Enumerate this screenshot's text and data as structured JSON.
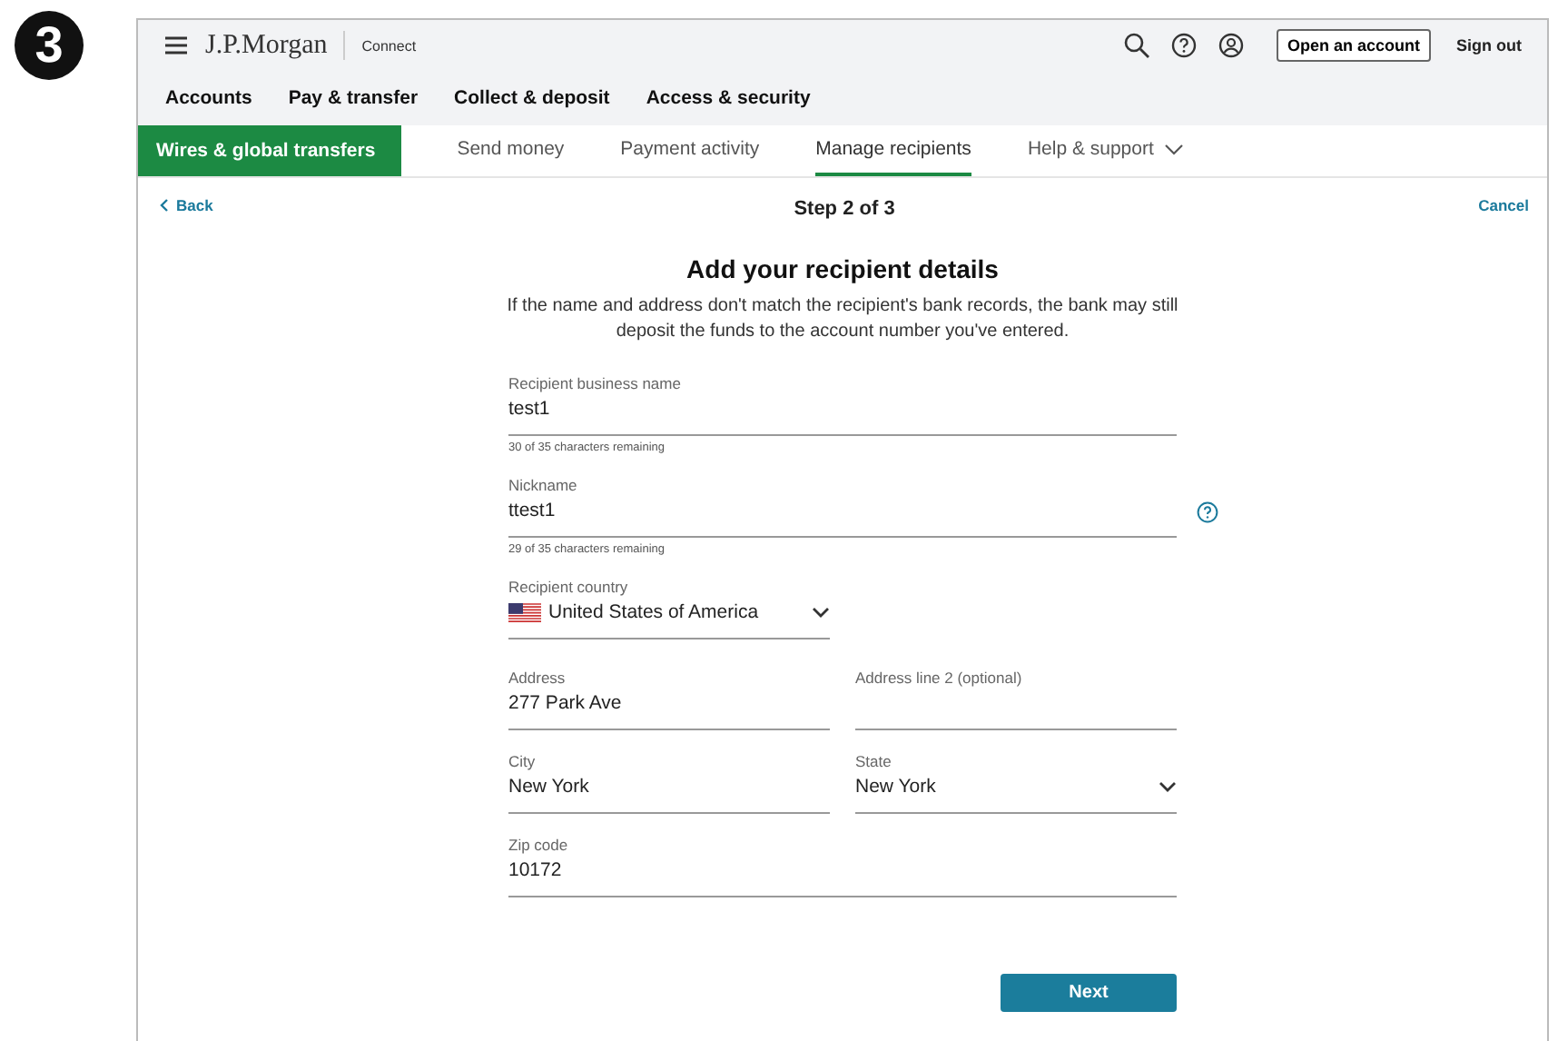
{
  "step_badge": "3",
  "header": {
    "brand": "J.P.Morgan",
    "product": "Connect",
    "open_account": "Open an account",
    "sign_out": "Sign out"
  },
  "main_nav": [
    "Accounts",
    "Pay & transfer",
    "Collect & deposit",
    "Access & security"
  ],
  "sub_nav": {
    "section": "Wires & global transfers",
    "tabs": [
      {
        "label": "Send money",
        "selected": false,
        "dropdown": false
      },
      {
        "label": "Payment activity",
        "selected": false,
        "dropdown": false
      },
      {
        "label": "Manage recipients",
        "selected": true,
        "dropdown": false
      },
      {
        "label": "Help & support",
        "selected": false,
        "dropdown": true
      }
    ]
  },
  "back": "Back",
  "step": "Step 2 of 3",
  "cancel": "Cancel",
  "form": {
    "title": "Add your recipient details",
    "description": "If the name and address don't match the recipient's bank records, the bank may still deposit the funds to the account number you've entered.",
    "rows": [
      [
        {
          "kind": "wide",
          "label": "Recipient business name",
          "value": "test1",
          "hint": "30 of 35 characters remaining",
          "help": false
        }
      ],
      [
        {
          "kind": "wide",
          "label": "Nickname",
          "value": "ttest1",
          "hint": "29 of 35 characters remaining",
          "help": true
        }
      ],
      [
        {
          "kind": "country",
          "label": "Recipient country",
          "value": "United States of America"
        }
      ],
      [
        {
          "kind": "text",
          "label": "Address",
          "value": "277 Park Ave"
        },
        {
          "kind": "text",
          "label": "Address line 2 (optional)"
        }
      ],
      [
        {
          "kind": "text",
          "label": "City",
          "value": "New York"
        },
        {
          "kind": "select",
          "label": "State",
          "value": "New York"
        }
      ],
      [
        {
          "kind": "text",
          "label": "Zip code",
          "value": "10172"
        }
      ]
    ],
    "next": "Next"
  }
}
